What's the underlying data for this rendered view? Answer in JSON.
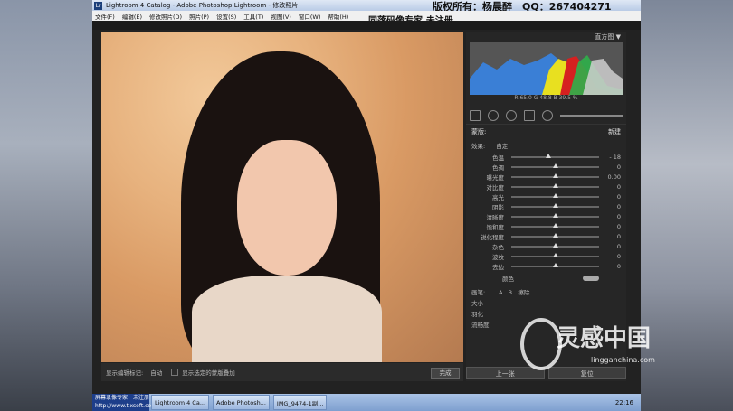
{
  "window": {
    "title": "Lightroom 4 Catalog - Adobe Photoshop Lightroom - 修改照片",
    "overlay_copyright": "版权所有：杨晨醉　QQ：267404271",
    "overlay_text": "同落码像专家.未注册"
  },
  "menu": [
    "文件(F)",
    "编辑(E)",
    "修改照片(D)",
    "照片(P)",
    "设置(S)",
    "工具(T)",
    "视图(V)",
    "窗口(W)",
    "帮助(H)"
  ],
  "panel": {
    "header": "直方图",
    "histogram_readout": "R 65.0 G 48.8 B 39.5 %",
    "mask_label": "蒙版:",
    "mask_new": "新建",
    "effect_label": "效果:",
    "effect_value": "自定",
    "sliders": [
      {
        "name": "色温",
        "value": "- 18",
        "pos": 0.42
      },
      {
        "name": "色调",
        "value": "0",
        "pos": 0.5
      },
      {
        "name": "曝光度",
        "value": "0.00",
        "pos": 0.5
      },
      {
        "name": "对比度",
        "value": "0",
        "pos": 0.5
      },
      {
        "name": "高光",
        "value": "0",
        "pos": 0.5
      },
      {
        "name": "阴影",
        "value": "0",
        "pos": 0.5
      },
      {
        "name": "清晰度",
        "value": "0",
        "pos": 0.5
      },
      {
        "name": "饱和度",
        "value": "0",
        "pos": 0.5
      },
      {
        "name": "锐化程度",
        "value": "0",
        "pos": 0.5
      },
      {
        "name": "杂色",
        "value": "0",
        "pos": 0.5
      },
      {
        "name": "波纹",
        "value": "0",
        "pos": 0.5
      },
      {
        "name": "去边",
        "value": "0",
        "pos": 0.5
      }
    ],
    "color_label": "颜色",
    "brush_label": "画笔:",
    "brush_a": "A",
    "brush_b": "B",
    "brush_erase": "擦除",
    "brush_size": "大小",
    "brush_feather": "羽化",
    "brush_flow": "流畅度",
    "btn_prev": "上一张",
    "btn_reset": "复位"
  },
  "filmstrip": {
    "label": "显示编辑标记:",
    "value": "自动",
    "checkbox_label": "显示选定的蒙版叠加",
    "done": "完成"
  },
  "taskbar": {
    "start_line1": "屏幕录像专家　未注册",
    "start_line2": "http://www.tlxsoft.com",
    "items": [
      "Lightroom 4 Ca...",
      "Adobe Photosh...",
      "IMG_9474-1副..."
    ],
    "clock": "22:16"
  },
  "watermark": {
    "brand": "灵感中国",
    "url": "lingganchina.com"
  }
}
